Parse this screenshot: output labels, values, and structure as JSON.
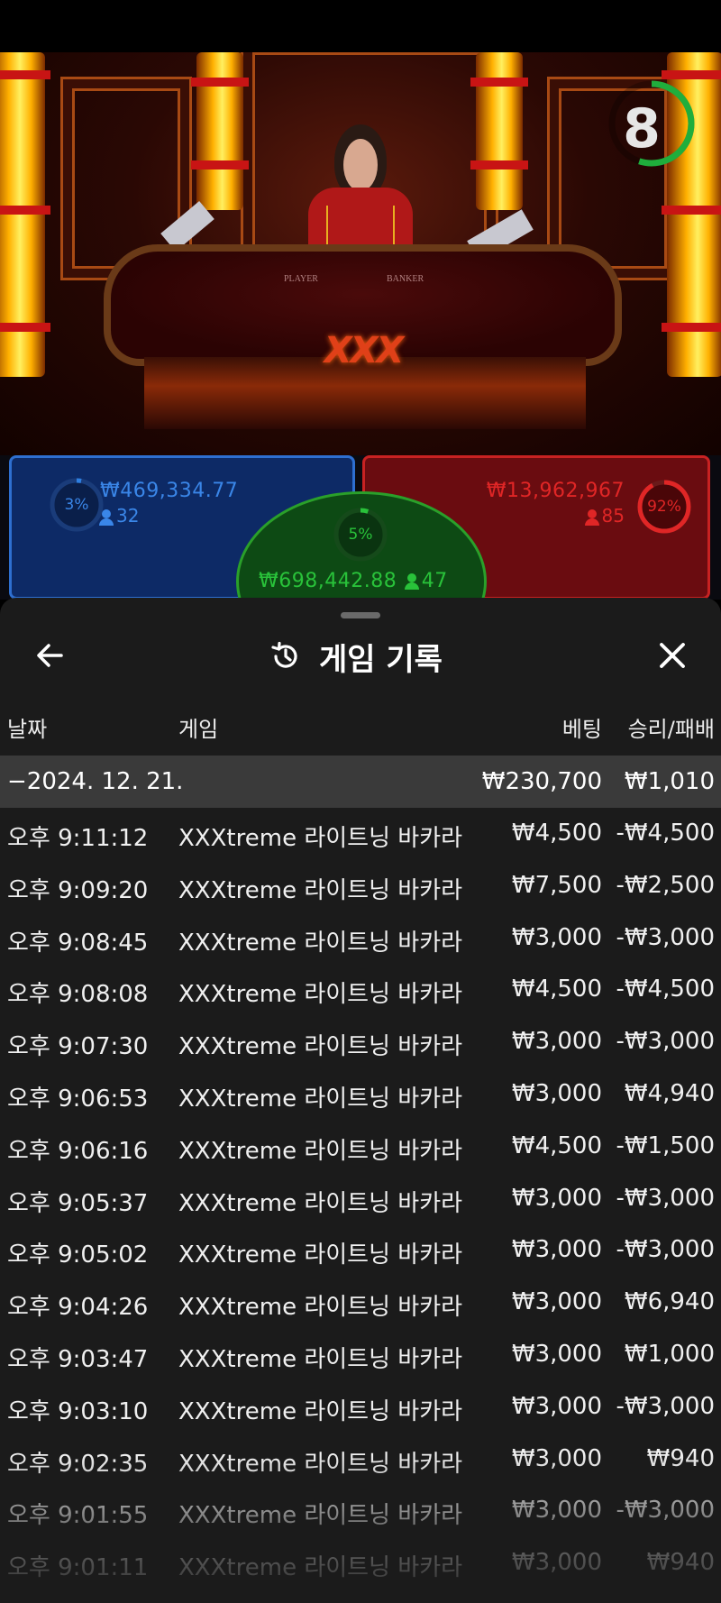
{
  "game_view": {
    "logo_text": "XXX",
    "table_labels": {
      "player": "PLAYER",
      "banker": "BANKER"
    },
    "timer": {
      "value": "8",
      "progress_fraction": 0.55,
      "color": "#1fae3c"
    }
  },
  "bets": {
    "player": {
      "percent": "3%",
      "amount": "₩469,334.77",
      "players": "32",
      "color": "#2e7fe0"
    },
    "banker": {
      "percent": "92%",
      "amount": "₩13,962,967",
      "players": "85",
      "color": "#e02626"
    },
    "tie": {
      "percent": "5%",
      "amount": "₩698,442.88",
      "players": "47",
      "color": "#29c23a"
    }
  },
  "history": {
    "title": "게임 기록",
    "icons": {
      "back": "back-arrow-icon",
      "history": "history-clock-icon",
      "close": "close-icon"
    },
    "columns": {
      "date": "날짜",
      "game": "게임",
      "bet": "베팅",
      "result": "승리/패배"
    },
    "date_group": {
      "label": "−2024. 12. 21.",
      "total_bet": "₩230,700",
      "total_result": "₩1,010"
    },
    "rows": [
      {
        "time": "오후 9:11:12",
        "game": "XXXtreme 라이트닝 바카라",
        "bet": "₩4,500",
        "result": "-₩4,500"
      },
      {
        "time": "오후 9:09:20",
        "game": "XXXtreme 라이트닝 바카라",
        "bet": "₩7,500",
        "result": "-₩2,500"
      },
      {
        "time": "오후 9:08:45",
        "game": "XXXtreme 라이트닝 바카라",
        "bet": "₩3,000",
        "result": "-₩3,000"
      },
      {
        "time": "오후 9:08:08",
        "game": "XXXtreme 라이트닝 바카라",
        "bet": "₩4,500",
        "result": "-₩4,500"
      },
      {
        "time": "오후 9:07:30",
        "game": "XXXtreme 라이트닝 바카라",
        "bet": "₩3,000",
        "result": "-₩3,000"
      },
      {
        "time": "오후 9:06:53",
        "game": "XXXtreme 라이트닝 바카라",
        "bet": "₩3,000",
        "result": "₩4,940"
      },
      {
        "time": "오후 9:06:16",
        "game": "XXXtreme 라이트닝 바카라",
        "bet": "₩4,500",
        "result": "-₩1,500"
      },
      {
        "time": "오후 9:05:37",
        "game": "XXXtreme 라이트닝 바카라",
        "bet": "₩3,000",
        "result": "-₩3,000"
      },
      {
        "time": "오후 9:05:02",
        "game": "XXXtreme 라이트닝 바카라",
        "bet": "₩3,000",
        "result": "-₩3,000"
      },
      {
        "time": "오후 9:04:26",
        "game": "XXXtreme 라이트닝 바카라",
        "bet": "₩3,000",
        "result": "₩6,940"
      },
      {
        "time": "오후 9:03:47",
        "game": "XXXtreme 라이트닝 바카라",
        "bet": "₩3,000",
        "result": "₩1,000"
      },
      {
        "time": "오후 9:03:10",
        "game": "XXXtreme 라이트닝 바카라",
        "bet": "₩3,000",
        "result": "-₩3,000"
      },
      {
        "time": "오후 9:02:35",
        "game": "XXXtreme 라이트닝 바카라",
        "bet": "₩3,000",
        "result": "₩940"
      },
      {
        "time": "오후 9:01:55",
        "game": "XXXtreme 라이트닝 바카라",
        "bet": "₩3,000",
        "result": "-₩3,000"
      },
      {
        "time": "오후 9:01:11",
        "game": "XXXtreme 라이트닝 바카라",
        "bet": "₩3,000",
        "result": "₩940"
      }
    ]
  }
}
